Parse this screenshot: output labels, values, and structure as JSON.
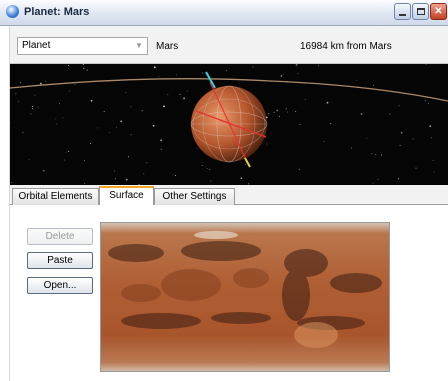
{
  "window": {
    "title": "Planet: Mars"
  },
  "toolbar": {
    "type_select": {
      "value": "Planet"
    },
    "planet_name": "Mars",
    "distance": "16984 km from Mars"
  },
  "tabs": [
    {
      "label": "Orbital Elements",
      "active": false
    },
    {
      "label": "Surface",
      "active": true
    },
    {
      "label": "Other Settings",
      "active": false
    }
  ],
  "surface": {
    "buttons": {
      "delete": {
        "label": "Delete",
        "enabled": false
      },
      "paste": {
        "label": "Paste",
        "enabled": true
      },
      "open": {
        "label": "Open...",
        "enabled": true
      }
    }
  },
  "icons": {
    "app": "globe-icon",
    "minimize": "minimize-icon",
    "maximize": "maximize-icon",
    "close": "close-icon",
    "dropdown": "chevron-down-icon"
  },
  "colors": {
    "accent_tab": "#f5a623",
    "space": "#050506",
    "mars": "#b0582c",
    "close_button": "#c43f22"
  }
}
